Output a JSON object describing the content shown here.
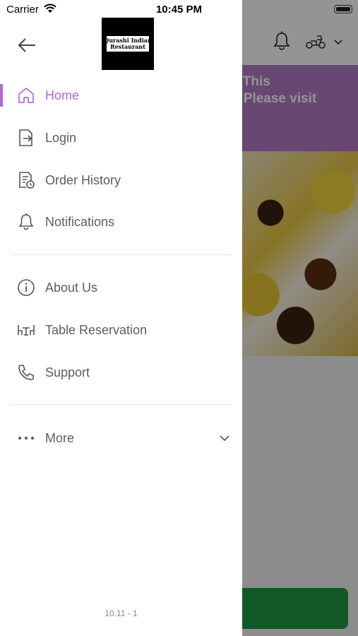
{
  "status_bar": {
    "carrier": "Carrier",
    "time": "10:45 PM"
  },
  "background": {
    "banner_text": "ed, This\non. Please visit\n/",
    "colors": {
      "banner": "#b37bc7",
      "button": "#1f9a46"
    }
  },
  "drawer": {
    "logo": {
      "line1": "Qurashi Indian",
      "line2": "Restaurant"
    },
    "accent_color": "#b26ad1",
    "items": [
      {
        "label": "Home",
        "icon": "home-icon",
        "active": true
      },
      {
        "label": "Login",
        "icon": "login-icon"
      },
      {
        "label": "Order History",
        "icon": "order-history-icon"
      },
      {
        "label": "Notifications",
        "icon": "bell-icon"
      },
      {
        "label": "About Us",
        "icon": "info-icon"
      },
      {
        "label": "Table Reservation",
        "icon": "table-icon"
      },
      {
        "label": "Support",
        "icon": "phone-icon"
      },
      {
        "label": "More",
        "icon": "more-dots-icon"
      }
    ],
    "version": "10.11 - 1"
  }
}
